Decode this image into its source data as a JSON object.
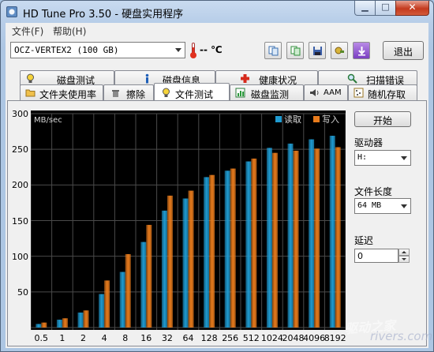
{
  "window": {
    "title": "HD Tune Pro 3.50 - 硬盘实用程序",
    "minimize_icon": "minimize-icon",
    "maximize_icon": "maximize-icon",
    "close_icon": "close-icon"
  },
  "menu": [
    {
      "label": "文件(F)"
    },
    {
      "label": "帮助(H)"
    }
  ],
  "toolbar": {
    "drive_value": "OCZ-VERTEX2 (100 GB)",
    "temperature_text": "-- ℃",
    "buttons": [
      {
        "icon": "copy-text-icon"
      },
      {
        "icon": "copy-screenshot-icon"
      },
      {
        "icon": "save-icon"
      },
      {
        "icon": "options-icon"
      },
      {
        "icon": "download-icon"
      }
    ],
    "exit_label": "退出"
  },
  "tabs_top": [
    {
      "label": "磁盘测试",
      "icon": "lightbulb-icon"
    },
    {
      "label": "磁盘信息",
      "icon": "info-icon"
    },
    {
      "label": "健康状况",
      "icon": "health-cross-icon"
    },
    {
      "label": "扫描错误",
      "icon": "magnifier-icon"
    }
  ],
  "tabs_bottom": [
    {
      "label": "文件夹使用率",
      "icon": "folder-icon"
    },
    {
      "label": "擦除",
      "icon": "trash-icon"
    },
    {
      "label": "文件测试",
      "icon": "file-test-icon",
      "active": true
    },
    {
      "label": "磁盘监测",
      "icon": "monitor-chart-icon"
    },
    {
      "label": "AAM",
      "icon": "speaker-icon"
    },
    {
      "label": "随机存取",
      "icon": "random-access-icon"
    }
  ],
  "controls": {
    "start_label": "开始",
    "drive_label": "驱动器",
    "drive_value": "H:",
    "file_length_label": "文件长度",
    "file_length_value": "64 MB",
    "delay_label": "延迟",
    "delay_value": "0"
  },
  "chart_data": {
    "type": "bar",
    "ylabel": "MB/sec",
    "ylim": [
      0,
      300
    ],
    "yticks": [
      50,
      100,
      150,
      200,
      250,
      300
    ],
    "categories": [
      "0.5",
      "1",
      "2",
      "4",
      "8",
      "16",
      "32",
      "64",
      "128",
      "256",
      "512",
      "1024",
      "2048",
      "4096",
      "8192"
    ],
    "series": [
      {
        "name": "读取",
        "color": "#1f9bd1",
        "values": [
          5,
          11,
          21,
          47,
          78,
          120,
          164,
          181,
          211,
          220,
          233,
          252,
          258,
          264,
          269
        ]
      },
      {
        "name": "写入",
        "color": "#e87b1c",
        "values": [
          7,
          13,
          24,
          66,
          103,
          144,
          185,
          192,
          214,
          223,
          237,
          245,
          248,
          251,
          253
        ]
      }
    ],
    "grid": true,
    "legend": "top-right"
  },
  "watermark": {
    "line1": "驱动之家",
    "line2": "rivers.com"
  }
}
